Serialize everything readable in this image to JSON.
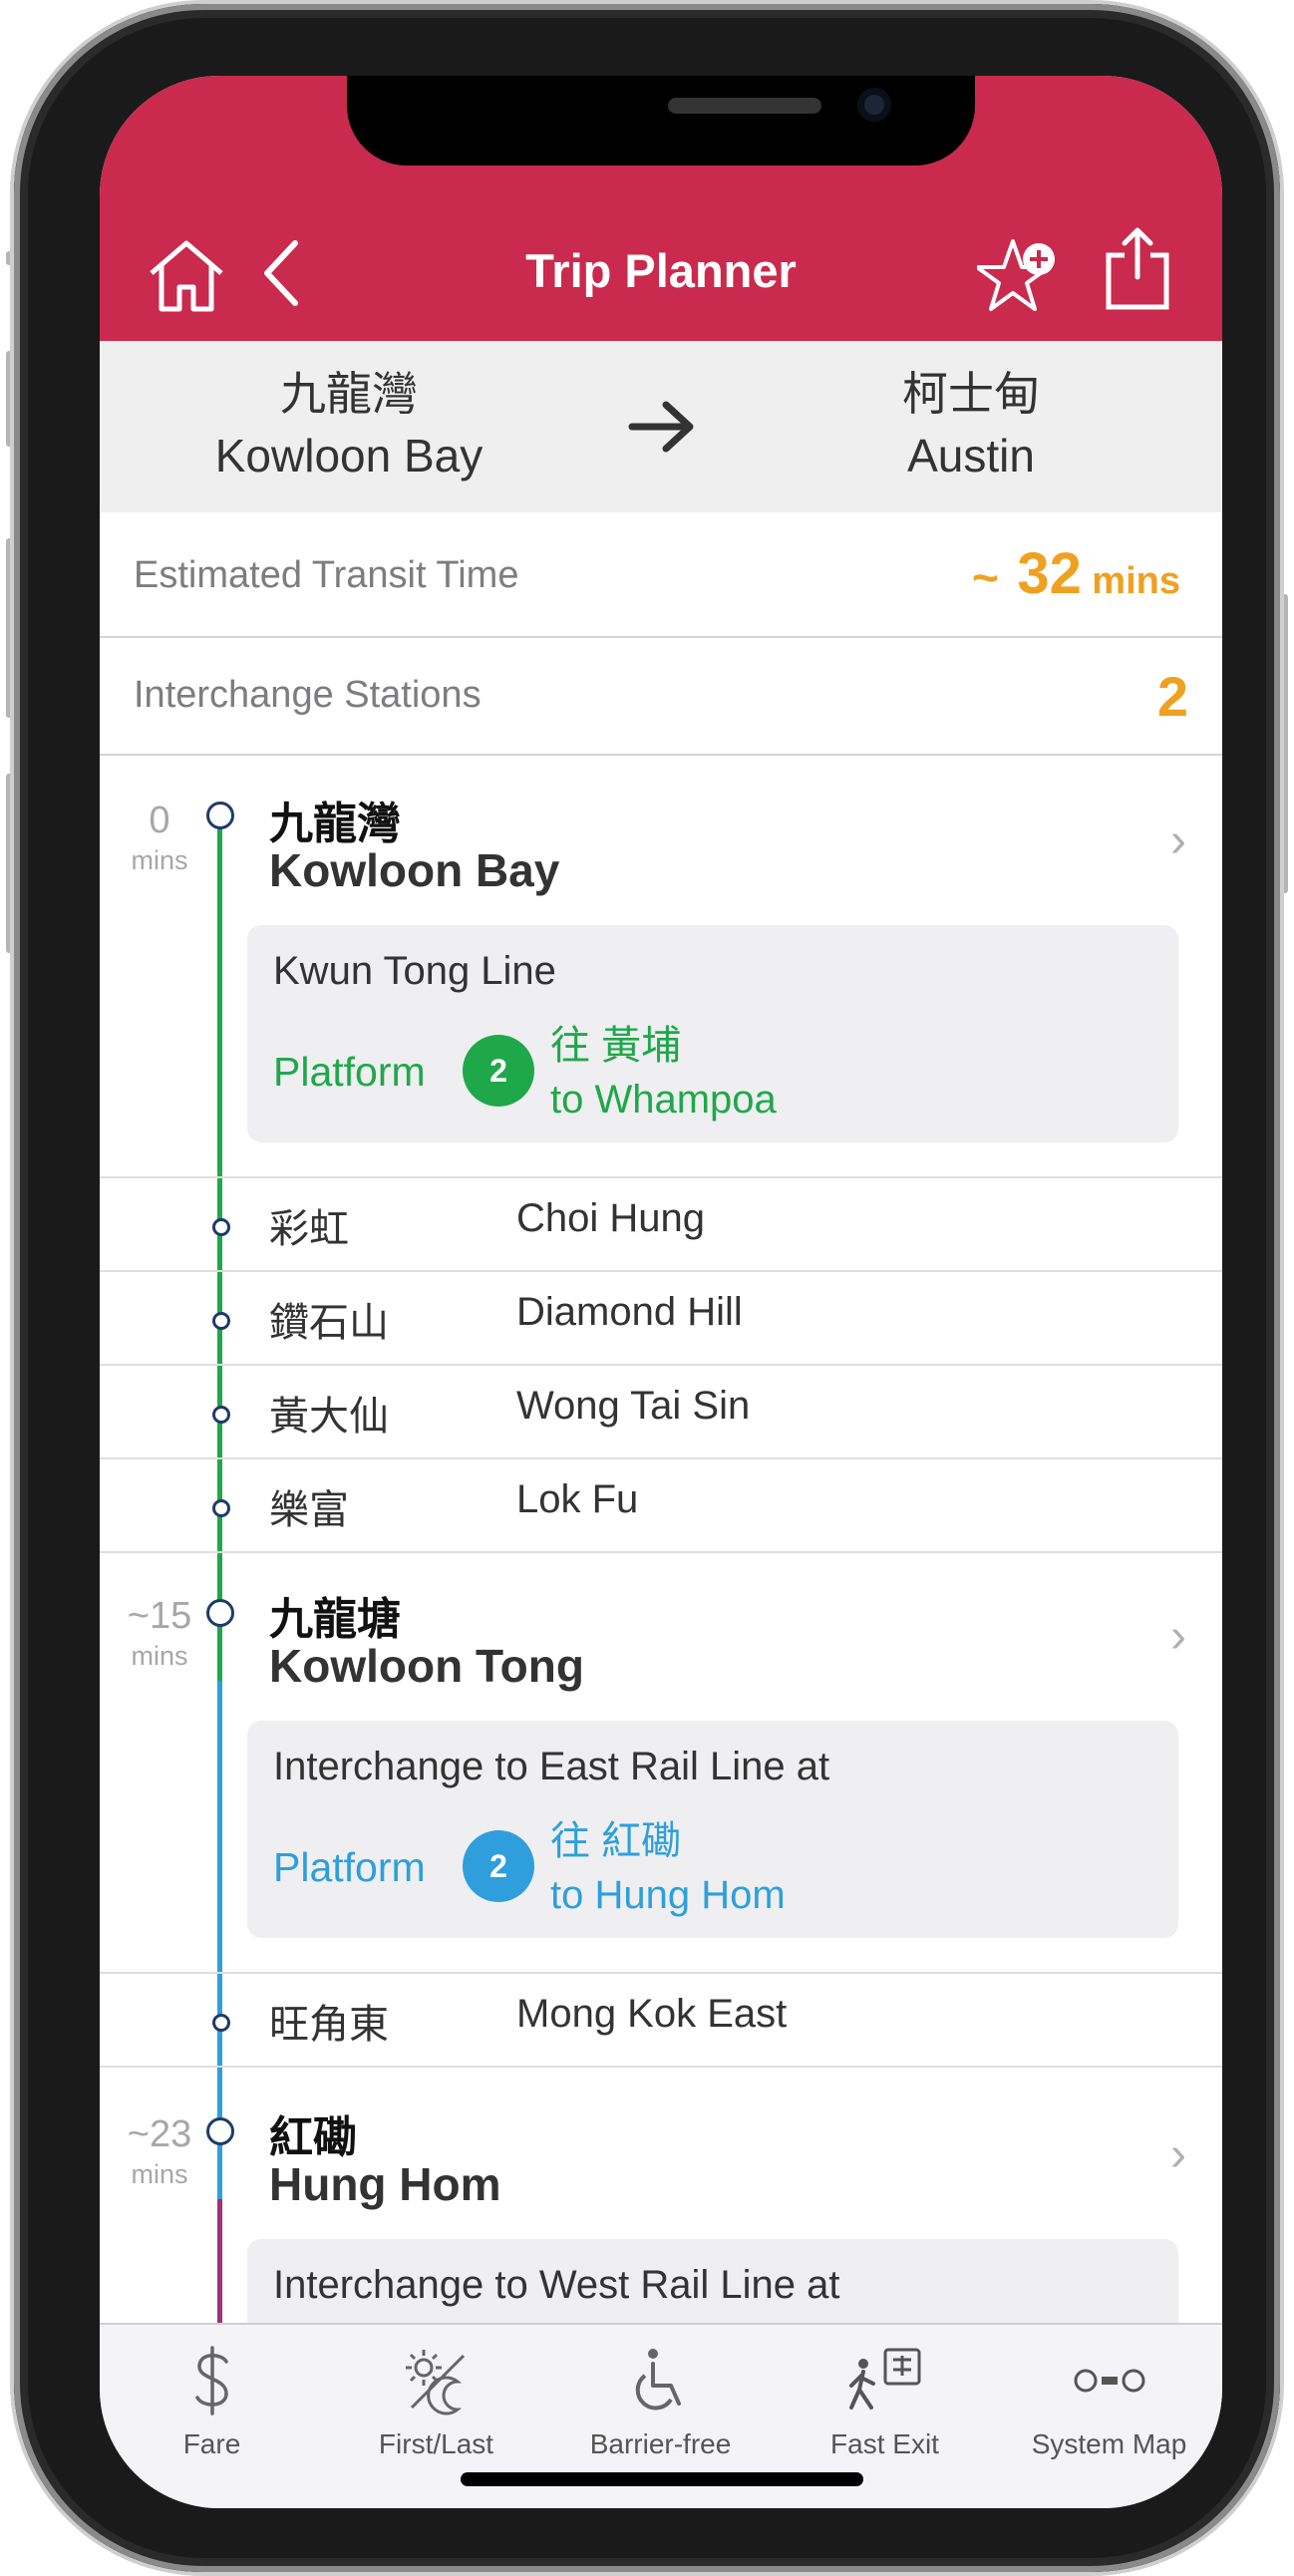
{
  "header": {
    "title": "Trip Planner",
    "bg_color": "#c92a4d"
  },
  "route": {
    "from_zh": "九龍灣",
    "from_en": "Kowloon Bay",
    "to_zh": "柯士甸",
    "to_en": "Austin"
  },
  "summary": {
    "transit_label": "Estimated Transit Time",
    "transit_prefix": "~",
    "transit_value": "32",
    "transit_unit": "mins",
    "interchange_label": "Interchange Stations",
    "interchange_value": "2"
  },
  "stops": {
    "kowloon_bay": {
      "time": "0",
      "unit": "mins",
      "zh": "九龍灣",
      "en": "Kowloon Bay",
      "card_title": "Kwun Tong Line",
      "platform_label": "Platform",
      "platform_no": "2",
      "dest_zh": "往 黃埔",
      "dest_en": "to Whampoa",
      "color": "#1fa84a"
    },
    "kowloon_tong": {
      "time": "~15",
      "unit": "mins",
      "zh": "九龍塘",
      "en": "Kowloon Tong",
      "card_title": "Interchange to East Rail Line at",
      "platform_label": "Platform",
      "platform_no": "2",
      "dest_zh": "往 紅磡",
      "dest_en": "to Hung Hom",
      "color": "#2e9fdc"
    },
    "hung_hom": {
      "time": "~23",
      "unit": "mins",
      "zh": "紅磡",
      "en": "Hung Hom",
      "card_title": "Interchange to West Rail Line at",
      "color": "#a1317a"
    }
  },
  "intermediate": [
    {
      "zh": "彩虹",
      "en": "Choi Hung"
    },
    {
      "zh": "鑽石山",
      "en": "Diamond Hill"
    },
    {
      "zh": "黃大仙",
      "en": "Wong Tai Sin"
    },
    {
      "zh": "樂富",
      "en": "Lok Fu"
    },
    {
      "zh": "旺角東",
      "en": "Mong Kok East"
    }
  ],
  "tabs": [
    {
      "label": "Fare",
      "icon": "dollar-icon"
    },
    {
      "label": "First/Last",
      "icon": "sun-moon-icon"
    },
    {
      "label": "Barrier-free",
      "icon": "wheelchair-icon"
    },
    {
      "label": "Fast Exit",
      "icon": "exit-icon"
    },
    {
      "label": "System Map",
      "icon": "system-map-icon"
    }
  ]
}
